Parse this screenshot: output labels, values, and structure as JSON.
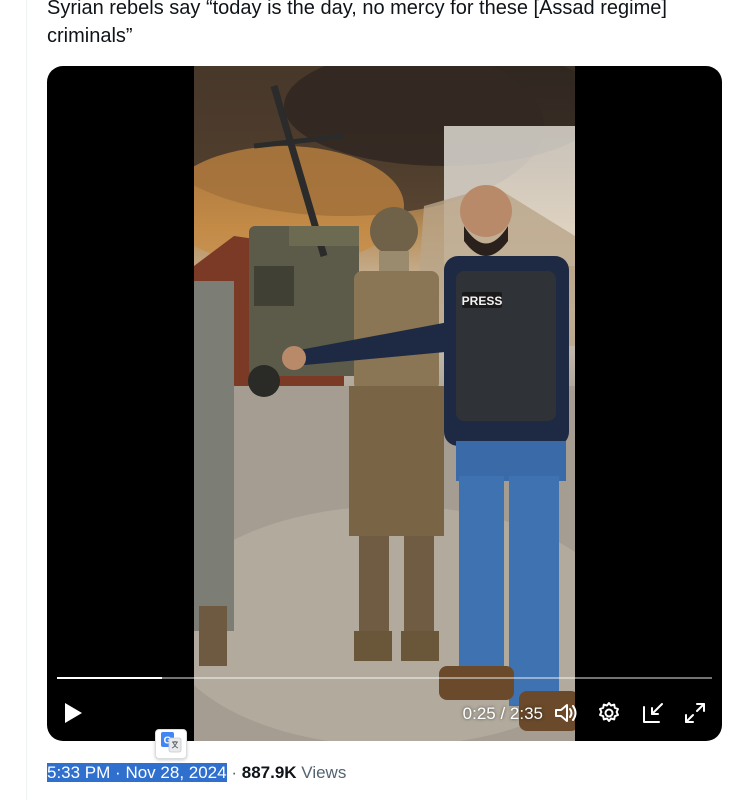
{
  "tweet": {
    "text": "Syrian rebels say “today is the day, no mercy for these [Assad regime]\ncriminals”"
  },
  "video": {
    "elapsed": "0:25",
    "duration": "2:35",
    "time_display": "0:25 / 2:35",
    "progress_fraction": 0.161,
    "press_label": "PRESS"
  },
  "meta": {
    "time": "5:33 PM",
    "separator": "·",
    "date": "Nov 28, 2024",
    "views_count": "887.9K",
    "views_label": "Views"
  },
  "icons": {
    "play": "play-icon",
    "volume": "volume-icon",
    "settings": "gear-icon",
    "dock": "dock-icon",
    "fullscreen": "fullscreen-icon",
    "translate": "google-translate-icon"
  },
  "colors": {
    "selection": "#2f6fce",
    "text": "#0f1419",
    "muted": "#536471"
  }
}
